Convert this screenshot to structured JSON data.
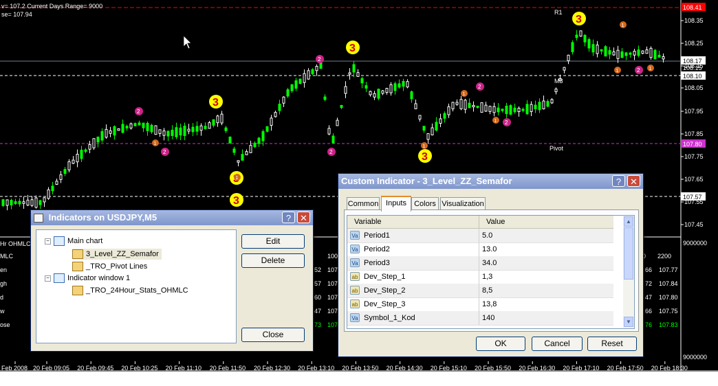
{
  "chart": {
    "info_line": "v= 107.2    Current Days Range= 9000",
    "close_line": "se= 107.94",
    "colors": {
      "background": "#000000",
      "bull": "#00ff00",
      "bear": "#ffffff",
      "price_line": "#708090",
      "red_line": "#ff0000",
      "magenta": "#cc33cc"
    },
    "price_labels": [
      "108.35",
      "108.25",
      "108.15",
      "108.05",
      "107.95",
      "107.85",
      "107.75",
      "107.65",
      "107.55",
      "107.45"
    ],
    "markers": {
      "red_price": "108.41",
      "current_price": "108.17",
      "current_sub": "108.15",
      "line_price": "108.10",
      "magenta_price": "107.80",
      "low_price": "107.57"
    },
    "level_labels": {
      "r1": "R1",
      "pivot": "Pivot",
      "m3": "M3"
    },
    "sub_scale": {
      "top": "9000000",
      "bottom": "9000000"
    },
    "stats_labels": [
      "Hr OHMLC",
      "MLC",
      "en",
      "gh",
      "d",
      "w",
      "ose"
    ],
    "stats_middle": {
      "header": "100",
      "rows": [
        [
          "52",
          "107"
        ],
        [
          "57",
          "107"
        ],
        [
          "60",
          "107"
        ],
        [
          "47",
          "107"
        ],
        [
          "73",
          "107"
        ]
      ]
    },
    "stats_right": {
      "header": [
        "0",
        "2200"
      ],
      "rows": [
        [
          "66",
          "107.77"
        ],
        [
          "72",
          "107.84"
        ],
        [
          "47",
          "107.80"
        ],
        [
          "66",
          "107.75"
        ],
        [
          "76",
          "107.83"
        ]
      ]
    },
    "time_labels": [
      "Feb 2008",
      "20 Feb 09:05",
      "20 Feb 09:45",
      "20 Feb 10:25",
      "20 Feb 11:10",
      "20 Feb 11:50",
      "20 Feb 12:30",
      "20 Feb 13:10",
      "20 Feb 13:50",
      "20 Feb 14:30",
      "20 Feb 15:10",
      "20 Feb 15:50",
      "20 Feb 16:30",
      "20 Feb 17:10",
      "20 Feb 17:50",
      "20 Feb 18:30"
    ]
  },
  "indicators_window": {
    "title": "Indicators on USDJPY,M5",
    "help_icon": "question-mark",
    "close_icon": "x",
    "tree": {
      "main_chart": "Main chart",
      "main_items": [
        "3_Level_ZZ_Semafor",
        "_TRO_Pivot Lines"
      ],
      "indicator_window": "Indicator window 1",
      "window_items": [
        "_TRO_24Hour_Stats_OHMLC"
      ]
    },
    "buttons": {
      "edit": "Edit",
      "delete": "Delete",
      "close": "Close"
    }
  },
  "custom_indicator": {
    "title": "Custom Indicator - 3_Level_ZZ_Semafor",
    "tabs": [
      "Common",
      "Inputs",
      "Colors",
      "Visualization"
    ],
    "active_tab": "Inputs",
    "columns": {
      "variable": "Variable",
      "value": "Value"
    },
    "rows": [
      {
        "name": "Period1",
        "value": "5.0",
        "type": "num"
      },
      {
        "name": "Period2",
        "value": "13.0",
        "type": "num"
      },
      {
        "name": "Period3",
        "value": "34.0",
        "type": "num"
      },
      {
        "name": "Dev_Step_1",
        "value": "1,3",
        "type": "str"
      },
      {
        "name": "Dev_Step_2",
        "value": "8,5",
        "type": "str"
      },
      {
        "name": "Dev_Step_3",
        "value": "13,8",
        "type": "str"
      },
      {
        "name": "Symbol_1_Kod",
        "value": "140",
        "type": "num"
      }
    ],
    "buttons": {
      "ok": "OK",
      "cancel": "Cancel",
      "reset": "Reset"
    }
  }
}
